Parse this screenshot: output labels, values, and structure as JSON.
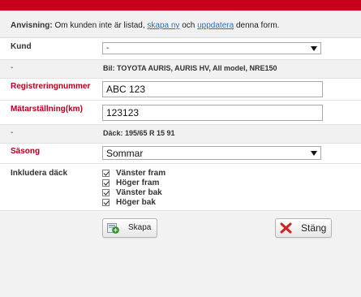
{
  "notice": {
    "title": "Anvisning:",
    "text_before": "Om kunden inte är listad,",
    "link_new": "skapa ny",
    "text_middle": "och",
    "link_update": "uppdatera",
    "text_after": "denna form."
  },
  "form": {
    "customer": {
      "label": "Kund",
      "value": "-"
    },
    "car": {
      "label": "-",
      "value": "Bil: TOYOTA AURIS, AURIS HV, All model, NRE150"
    },
    "registration": {
      "label": "Registreringnummer",
      "value": "ABC 123"
    },
    "odometer": {
      "label": "Mätarställning(km)",
      "value": "123123"
    },
    "tire": {
      "label": "-",
      "value": "Däck: 195/65 R 15 91"
    },
    "season": {
      "label": "Säsong",
      "value": "Sommar"
    },
    "include_tires": {
      "label": "Inkludera däck",
      "options": [
        {
          "label": "Vänster fram",
          "checked": true
        },
        {
          "label": "Höger fram",
          "checked": true
        },
        {
          "label": "Vänster bak",
          "checked": true
        },
        {
          "label": "Höger bak",
          "checked": true
        }
      ]
    }
  },
  "buttons": {
    "create": {
      "label": "Skapa",
      "icon": "create-icon"
    },
    "close": {
      "label": "Stäng",
      "icon": "close-icon"
    }
  },
  "colors": {
    "header_red": "#c8001e",
    "label_red": "#b0001e",
    "link_blue": "#2a6fc9"
  }
}
